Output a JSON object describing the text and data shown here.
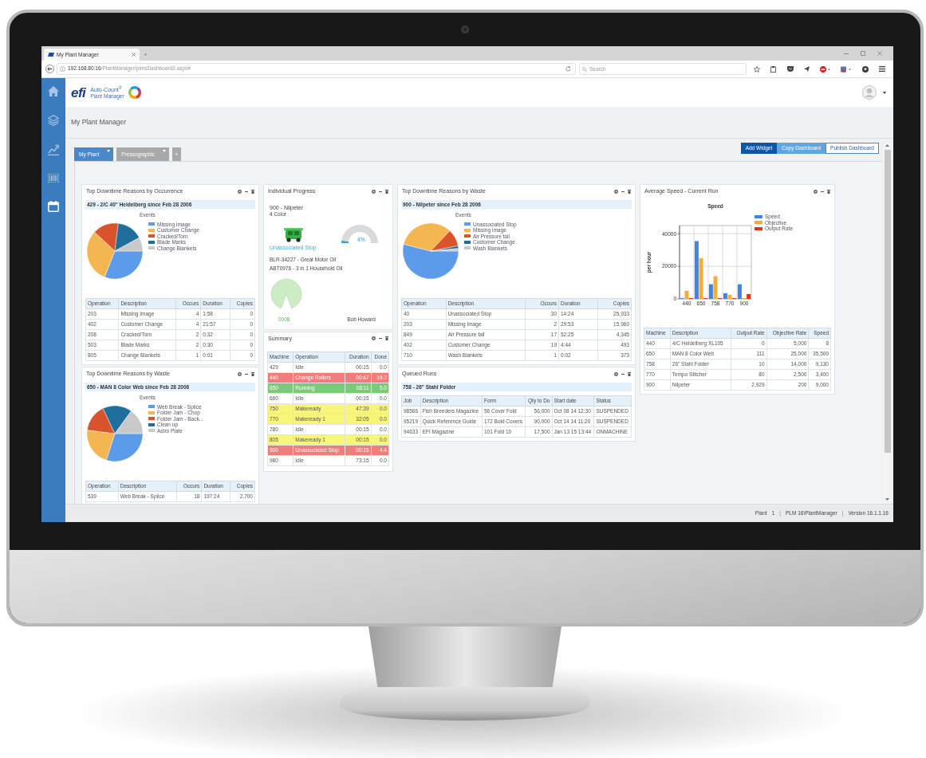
{
  "browser": {
    "tab_title": "My Plant Manager",
    "new_tab": "+",
    "url_host": "192.168.80.16",
    "url_path": "/PlantManager/plmsDashboard2.aspx#",
    "search_placeholder": "Search"
  },
  "sidebar": {
    "items": [
      {
        "kind": "home",
        "selected": false
      },
      {
        "kind": "layers",
        "selected": false
      },
      {
        "kind": "chart",
        "selected": false
      },
      {
        "kind": "barcode",
        "selected": false
      },
      {
        "kind": "calendar",
        "selected": true
      }
    ]
  },
  "header": {
    "logo": "efi",
    "product": "Auto-Count$^{®}$",
    "subtitle": "Plant Manager"
  },
  "page_title": "My Plant Manager",
  "dashboard_tabs": [
    {
      "label": "My Plant",
      "selected": true
    },
    {
      "label": "Pressographic",
      "selected": false
    }
  ],
  "add_tab": "+",
  "actions": [
    {
      "label": "Add Widget",
      "kind": "primary"
    },
    {
      "label": "Copy Dashboard",
      "kind": "secondary"
    },
    {
      "label": "Publish Dashboard",
      "kind": "outline"
    }
  ],
  "columns": [
    [
      {
        "kind": "pie_table",
        "title": "Top Downtime Reasons by Occurrence",
        "subtitle": "429 - 2/C 40\" Heidelberg since Feb 28 2006",
        "chart_title": "Events",
        "legend": [
          {
            "label": "Missing Image",
            "color": "#5b9bea"
          },
          {
            "label": "Customer Change",
            "color": "#f4b650"
          },
          {
            "label": "Cracked/Torn",
            "color": "#d9542c"
          },
          {
            "label": "Blade Marks",
            "color": "#1f6e9c"
          },
          {
            "label": "Change Blankets",
            "color": "#c9c9c9"
          }
        ],
        "table": {
          "columns": [
            {
              "label": "Operation",
              "numeric": false
            },
            {
              "label": "Description",
              "numeric": false
            },
            {
              "label": "Occurs",
              "numeric": true
            },
            {
              "label": "Duration",
              "numeric": false
            },
            {
              "label": "Copies",
              "numeric": true
            }
          ],
          "rows": [
            [
              "203",
              "Missing Image",
              "4",
              "1:58",
              "0"
            ],
            [
              "402",
              "Customer Change",
              "4",
              "21:57",
              "0"
            ],
            [
              "208",
              "Cracked/Torn",
              "2",
              "0:32",
              "0"
            ],
            [
              "503",
              "Blade Marks",
              "2",
              "0:30",
              "0"
            ],
            [
              "805",
              "Change Blankets",
              "1",
              "0:01",
              "0"
            ]
          ]
        }
      },
      {
        "kind": "pie_table",
        "title": "Top Downtime Reasons by Waste",
        "subtitle": "650 - MAN 8 Color Web since Feb 28 2006",
        "chart_title": "Events",
        "legend": [
          {
            "label": "Web Break - Splice",
            "color": "#5b9bea"
          },
          {
            "label": "Folder Jam - Chop",
            "color": "#f4b650"
          },
          {
            "label": "Folder Jam - Back...",
            "color": "#d9542c"
          },
          {
            "label": "Clean up",
            "color": "#1f6e9c"
          },
          {
            "label": "Astro Plate",
            "color": "#c9c9c9"
          }
        ],
        "table": {
          "columns": [
            {
              "label": "Operation",
              "numeric": false
            },
            {
              "label": "Description",
              "numeric": false
            },
            {
              "label": "Occurs",
              "numeric": true
            },
            {
              "label": "Duration",
              "numeric": false
            },
            {
              "label": "Copies",
              "numeric": true
            }
          ],
          "rows": [
            [
              "539",
              "Web Break - Splice",
              "18",
              "197:24",
              "2,700"
            ]
          ]
        }
      }
    ],
    [
      {
        "kind": "progress",
        "title": "Individual Progress",
        "machine": "900 - Nilpeter",
        "machine_detail": "4 Color",
        "state": "Unassociated Stop",
        "gauge": {
          "level": 0.04,
          "reading": "4%"
        },
        "jobs": [
          "BLR-34227 - Great Motor Oil",
          "ABT0976 - 3 in 1 Household Oil"
        ],
        "counter": "0008",
        "operator": "Bob Howard"
      },
      {
        "kind": "status_table",
        "title": "Summary",
        "table": {
          "columns": [
            {
              "label": "Machine",
              "numeric": false
            },
            {
              "label": "Operation",
              "numeric": false
            },
            {
              "label": "Duration",
              "numeric": true
            },
            {
              "label": "Done",
              "numeric": true
            }
          ],
          "rows": [
            {
              "cells": [
                "429",
                "Idle",
                "00:15",
                "0.0"
              ],
              "color": "#ffffff"
            },
            {
              "cells": [
                "440",
                "Change Rollers",
                "00:47",
                "19.7"
              ],
              "color": "#f07c7c"
            },
            {
              "cells": [
                "650",
                "Running",
                "08:11",
                "5.0"
              ],
              "color": "#7cc97c"
            },
            {
              "cells": [
                "660",
                "Idle",
                "00:15",
                "0.0"
              ],
              "color": "#ffffff"
            },
            {
              "cells": [
                "750",
                "Makeready",
                "47:39",
                "0.0"
              ],
              "color": "#f8f57a"
            },
            {
              "cells": [
                "770",
                "Makeready 1",
                "32:05",
                "0.0"
              ],
              "color": "#f8f57a"
            },
            {
              "cells": [
                "780",
                "Idle",
                "00:15",
                "0.0"
              ],
              "color": "#ffffff"
            },
            {
              "cells": [
                "805",
                "Makeready 1",
                "00:15",
                "0.0"
              ],
              "color": "#f8f57a"
            },
            {
              "cells": [
                "900",
                "Unassociated Stop",
                "00:15",
                "4.4"
              ],
              "color": "#f07c7c"
            },
            {
              "cells": [
                "980",
                "Idle",
                "73:15",
                "0.0"
              ],
              "color": "#ffffff"
            }
          ]
        }
      }
    ],
    [
      {
        "kind": "pie_table",
        "title": "Top Downtime Reasons by Waste",
        "subtitle": "900 - Nilpeter since Feb 28 2006",
        "chart_title": "Events",
        "legend": [
          {
            "label": "Unassociated Stop",
            "color": "#5b9bea"
          },
          {
            "label": "Missing Image",
            "color": "#f4b650"
          },
          {
            "label": "Air Pressure fail",
            "color": "#d9542c"
          },
          {
            "label": "Customer Change",
            "color": "#1f6e9c"
          },
          {
            "label": "Wash Blankets",
            "color": "#c9c9c9"
          }
        ],
        "table": {
          "columns": [
            {
              "label": "Operation",
              "numeric": false
            },
            {
              "label": "Description",
              "numeric": false
            },
            {
              "label": "Occurs",
              "numeric": true
            },
            {
              "label": "Duration",
              "numeric": false
            },
            {
              "label": "Copies",
              "numeric": true
            }
          ],
          "rows": [
            [
              "40",
              "Unassociated Stop",
              "30",
              "14:24",
              "25,933"
            ],
            [
              "203",
              "Missing Image",
              "2",
              "29:53",
              "15,960"
            ],
            [
              "849",
              "Air Pressure fail",
              "17",
              "52:25",
              "4,345"
            ],
            [
              "402",
              "Customer Change",
              "19",
              "4:44",
              "493"
            ],
            [
              "710",
              "Wash Blankets",
              "1",
              "0:02",
              "373"
            ]
          ]
        }
      },
      {
        "kind": "table",
        "title": "Queued Runs",
        "subtitle": "758 - 26\" Stahl Folder",
        "table": {
          "columns": [
            {
              "label": "Job",
              "numeric": false
            },
            {
              "label": "Description",
              "numeric": false
            },
            {
              "label": "Form",
              "numeric": false
            },
            {
              "label": "Qty to Do",
              "numeric": true
            },
            {
              "label": "Start date",
              "numeric": false
            },
            {
              "label": "Status",
              "numeric": false
            }
          ],
          "rows": [
            [
              "98566",
              "Fish Breeders Magazine",
              "56 Cover Fold",
              "56,000",
              "Oct 08 14 12:30",
              "SUSPENDED"
            ],
            [
              "95219",
              "Quick Reference Guide",
              "172 Bold Covers",
              "90,000",
              "Oct 14 14 11:20",
              "SUSPENDED"
            ],
            [
              "94633",
              "EFI Magazine",
              "101 Fold 10",
              "17,500",
              "Jan 13 15 13:44",
              "ONMACHINE"
            ]
          ]
        }
      }
    ],
    [
      {
        "kind": "bar_chart_table",
        "title": "Average Speed - Current Run",
        "chart_data": {
          "type": "bar",
          "title": "Speed",
          "ylabel": "per hour",
          "categories": [
            "440",
            "650",
            "758",
            "770",
            "900"
          ],
          "series": [
            {
              "name": "Speed",
              "color": "#3d86e6",
              "values": [
                0,
                35500,
                9000,
                3500,
                9000
              ]
            },
            {
              "name": "Objective",
              "color": "#f2ad3d",
              "values": [
                5000,
                25000,
                14000,
                2500,
                200
              ]
            },
            {
              "name": "Output Rate",
              "color": "#d8361e",
              "values": [
                0,
                0,
                0,
                0,
                3000
              ]
            }
          ],
          "ylim": [
            0,
            45000
          ],
          "yticks": [
            0,
            20000,
            40000
          ],
          "legend": "upper right"
        },
        "table": {
          "columns": [
            {
              "label": "Machine",
              "numeric": false
            },
            {
              "label": "Description",
              "numeric": false
            },
            {
              "label": "Output Rate",
              "numeric": true
            },
            {
              "label": "Objective Rate",
              "numeric": true
            },
            {
              "label": "Speed",
              "numeric": true
            }
          ],
          "rows": [
            [
              "440",
              "4/C Heidelberg XL105",
              "0",
              "5,000",
              "8"
            ],
            [
              "650",
              "MAN 8 Color Web",
              "111",
              "25,000",
              "35,500"
            ],
            [
              "758",
              "26\" Stahl Folder",
              "10",
              "14,000",
              "9,130"
            ],
            [
              "770",
              "Tempo Stitcher",
              "80",
              "2,500",
              "3,400"
            ],
            [
              "900",
              "Nilpeter",
              "2,929",
              "200",
              "9,000"
            ]
          ]
        }
      }
    ]
  ],
  "status_bar": [
    {
      "kind": "text",
      "text": "Plant"
    },
    {
      "kind": "text",
      "text": "1"
    },
    {
      "kind": "separator",
      "text": "|"
    },
    {
      "kind": "text",
      "text": "PLM 16\\PlantManager"
    },
    {
      "kind": "separator",
      "text": "|"
    },
    {
      "kind": "text",
      "text": "Version 16.1.1.16"
    }
  ]
}
